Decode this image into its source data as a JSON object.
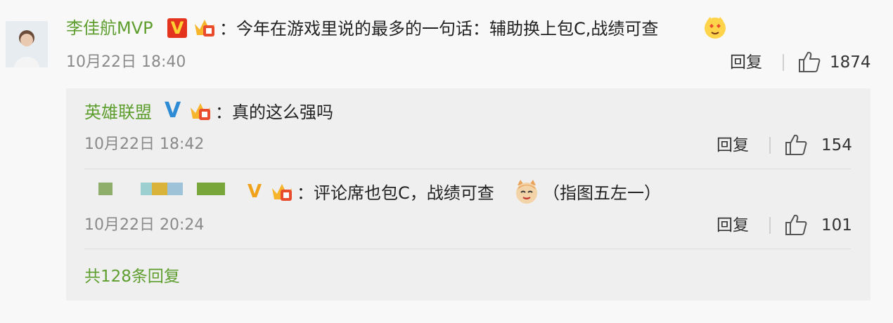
{
  "comment": {
    "author": "李佳航MVP",
    "text": "：今年在游戏里说的最多的一句话：辅助换上包C,战绩可查",
    "time": "10月22日 18:40",
    "reply_label": "回复",
    "likes": "1874"
  },
  "replies": [
    {
      "author": "英雄联盟",
      "text": "：真的这么强吗",
      "time": "10月22日 18:42",
      "reply_label": "回复",
      "likes": "154"
    },
    {
      "author": "",
      "text": "：评论席也包C，战绩可查",
      "text_after": "（指图五左一）",
      "time": "10月22日 20:24",
      "reply_label": "回复",
      "likes": "101"
    }
  ],
  "more_replies": "共128条回复",
  "badges": {
    "v_red": "V",
    "v_blue": "V",
    "v_gold": "V"
  },
  "colors": {
    "username": "#5e9e2e",
    "verified_red": "#e5341d",
    "verified_blue": "#2e8bd6",
    "verified_gold": "#f0a21c"
  },
  "icons": [
    "avatar",
    "verified-icon",
    "crown-member-icon",
    "emoji-icon",
    "thumbs-up-icon",
    "cat-emoji-icon"
  ]
}
